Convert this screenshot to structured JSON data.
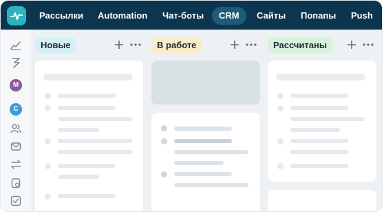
{
  "nav": {
    "items": [
      "Рассылки",
      "Automation",
      "Чат-боты",
      "CRM",
      "Сайты",
      "Попапы",
      "Push"
    ],
    "active": "CRM"
  },
  "sidebar": {
    "icons": [
      "chart-icon",
      "lightning-icon",
      "users-icon",
      "mail-icon",
      "transfer-icon",
      "clipboard-icon",
      "checkbox-icon"
    ],
    "avatars": [
      {
        "letter": "M",
        "color": "#8b5a9c"
      },
      {
        "letter": "C",
        "color": "#3a9bd9"
      }
    ]
  },
  "board": {
    "columns": [
      {
        "title": "Новые",
        "color": "#d6f0f7"
      },
      {
        "title": "В работе",
        "color": "#f9ecc8"
      },
      {
        "title": "Рассчитаны",
        "color": "#d7f2dd"
      }
    ]
  },
  "colors": {
    "topbar": "#0c3550",
    "logo": "#2bb3c2",
    "active_nav": "#1e5b78"
  }
}
